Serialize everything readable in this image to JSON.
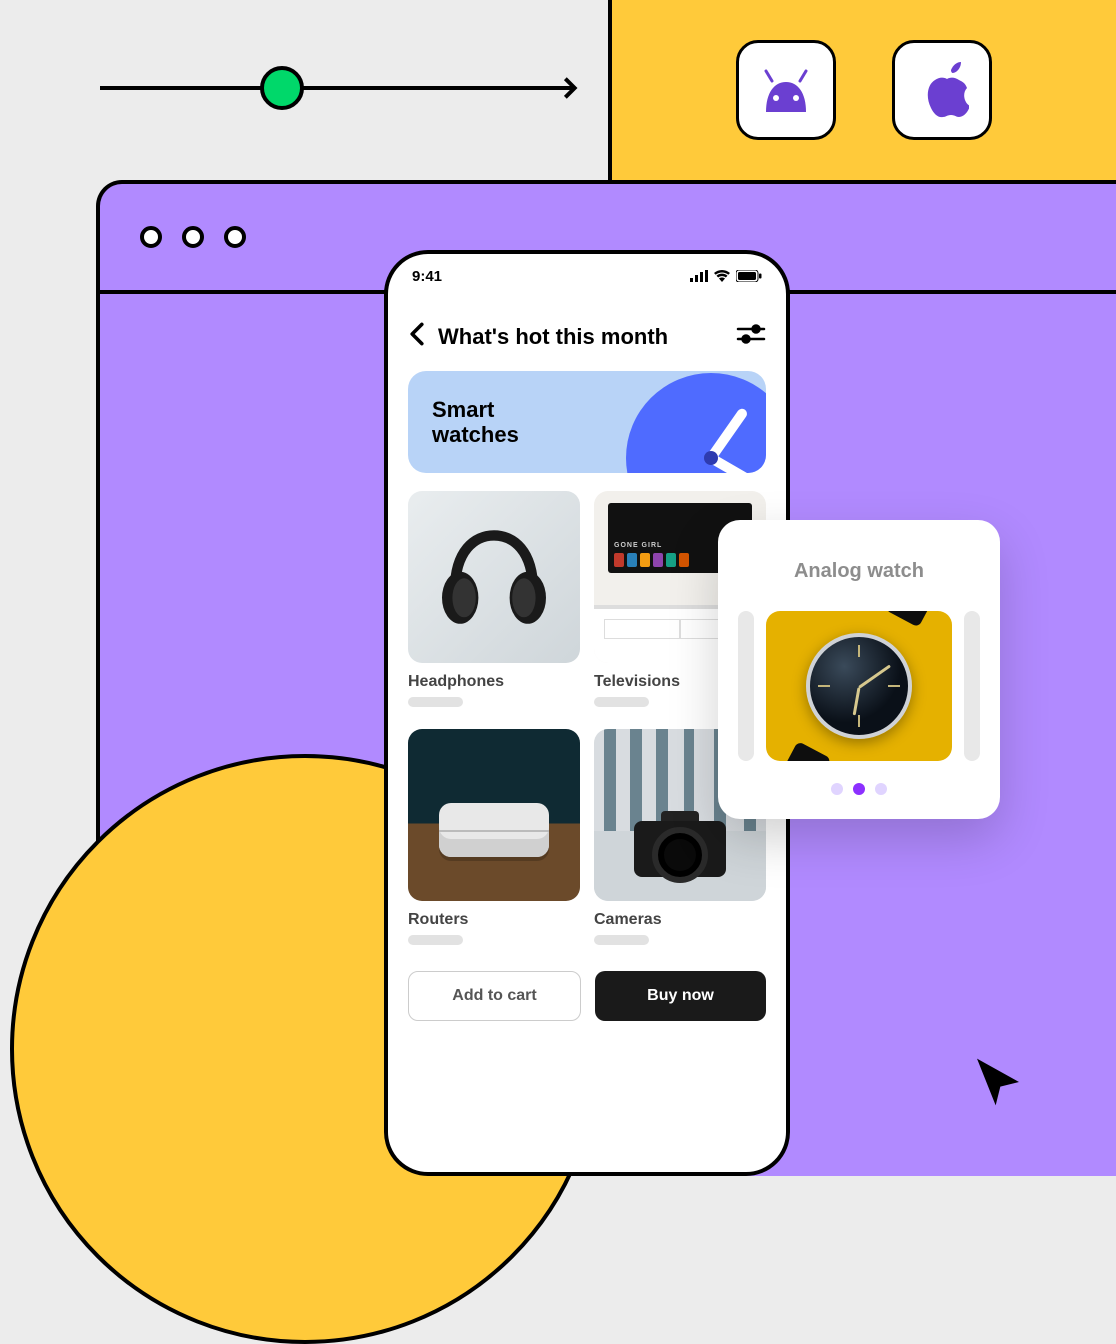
{
  "platforms": {
    "android_icon": "android-icon",
    "apple_icon": "apple-icon"
  },
  "colors": {
    "accent_purple": "#b18aff",
    "accent_yellow": "#ffca3a",
    "accent_green": "#00d86a",
    "brand_purple": "#8c30ff",
    "clock_blue": "#4f6bff",
    "hero_bg": "#b8d3f7"
  },
  "phone": {
    "status": {
      "time": "9:41"
    },
    "header": {
      "title": "What's hot this month"
    },
    "hero": {
      "title": "Smart watches"
    },
    "categories": [
      {
        "label": "Headphones"
      },
      {
        "label": "Televisions"
      },
      {
        "label": "Routers"
      },
      {
        "label": "Cameras"
      }
    ],
    "tv_screen_title": "GONE GIRL",
    "actions": {
      "add_to_cart": "Add to cart",
      "buy_now": "Buy now"
    }
  },
  "product_card": {
    "title": "Analog watch",
    "carousel": {
      "active_index": 1,
      "count": 3
    }
  }
}
